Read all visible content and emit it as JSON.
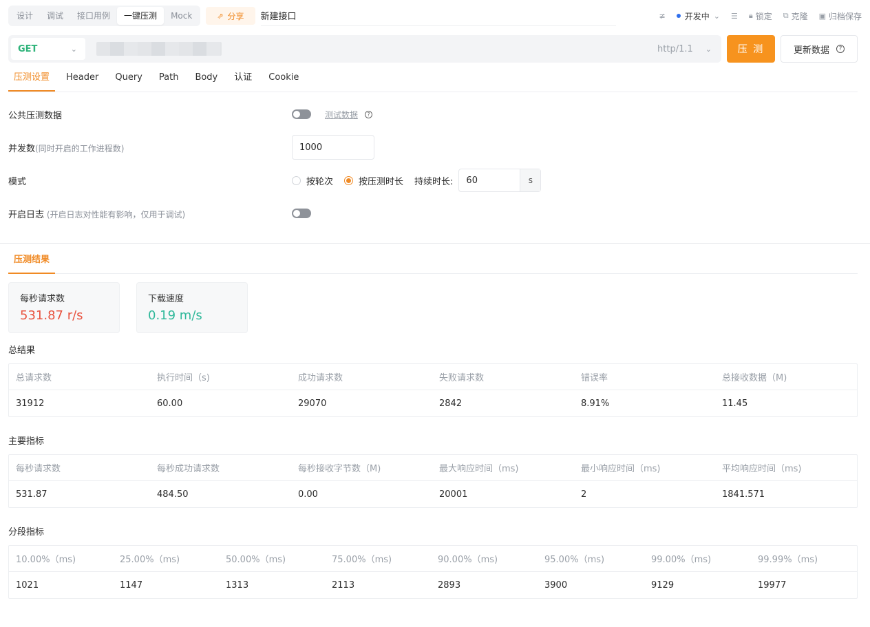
{
  "top": {
    "mode_tabs": [
      "设计",
      "调试",
      "接口用例",
      "一键压测",
      "Mock"
    ],
    "share": "分享",
    "title": "新建接口",
    "env": "开发中",
    "lock": "锁定",
    "clone": "克隆",
    "archive": "归档保存"
  },
  "request": {
    "method": "GET",
    "protocol": "http/1.1",
    "run_label": "压 测",
    "update_label": "更新数据"
  },
  "subtabs": [
    "压测设置",
    "Header",
    "Query",
    "Path",
    "Body",
    "认证",
    "Cookie"
  ],
  "settings": {
    "public_data": {
      "label": "公共压测数据",
      "link": "测试数据"
    },
    "concurrency": {
      "label": "并发数",
      "hint": "(同时开启的工作进程数)",
      "value": "1000"
    },
    "mode": {
      "label": "模式",
      "option_rounds": "按轮次",
      "option_duration": "按压测时长",
      "duration_label": "持续时长:",
      "duration_value": "60",
      "unit": "s"
    },
    "log": {
      "label": "开启日志",
      "hint": " (开启日志对性能有影响，仅用于调试)"
    }
  },
  "results": {
    "tab": "压测结果",
    "rps_label": "每秒请求数",
    "rps_value": "531.87 r/s",
    "download_label": "下载速度",
    "download_value": "0.19 m/s",
    "total": {
      "title": "总结果",
      "headers": [
        "总请求数",
        "执行时间（s)",
        "成功请求数",
        "失败请求数",
        "错误率",
        "总接收数据（M)"
      ],
      "values": [
        "31912",
        "60.00",
        "29070",
        "2842",
        "8.91%",
        "11.45"
      ]
    },
    "main": {
      "title": "主要指标",
      "headers": [
        "每秒请求数",
        "每秒成功请求数",
        "每秒接收字节数（M)",
        "最大响应时间（ms)",
        "最小响应时间（ms)",
        "平均响应时间（ms)"
      ],
      "values": [
        "531.87",
        "484.50",
        "0.00",
        "20001",
        "2",
        "1841.571"
      ]
    },
    "segment": {
      "title": "分段指标",
      "headers": [
        "10.00%（ms)",
        "25.00%（ms)",
        "50.00%（ms)",
        "75.00%（ms)",
        "90.00%（ms)",
        "95.00%（ms)",
        "99.00%（ms)",
        "99.99%（ms)"
      ],
      "values": [
        "1021",
        "1147",
        "1313",
        "2113",
        "2893",
        "3900",
        "9129",
        "19977"
      ]
    }
  },
  "colors": {
    "accent": "#f08a24",
    "get": "#2eb37a",
    "rps": "#e8533f",
    "download": "#2fb89a",
    "env_dot": "#2f6fed"
  }
}
